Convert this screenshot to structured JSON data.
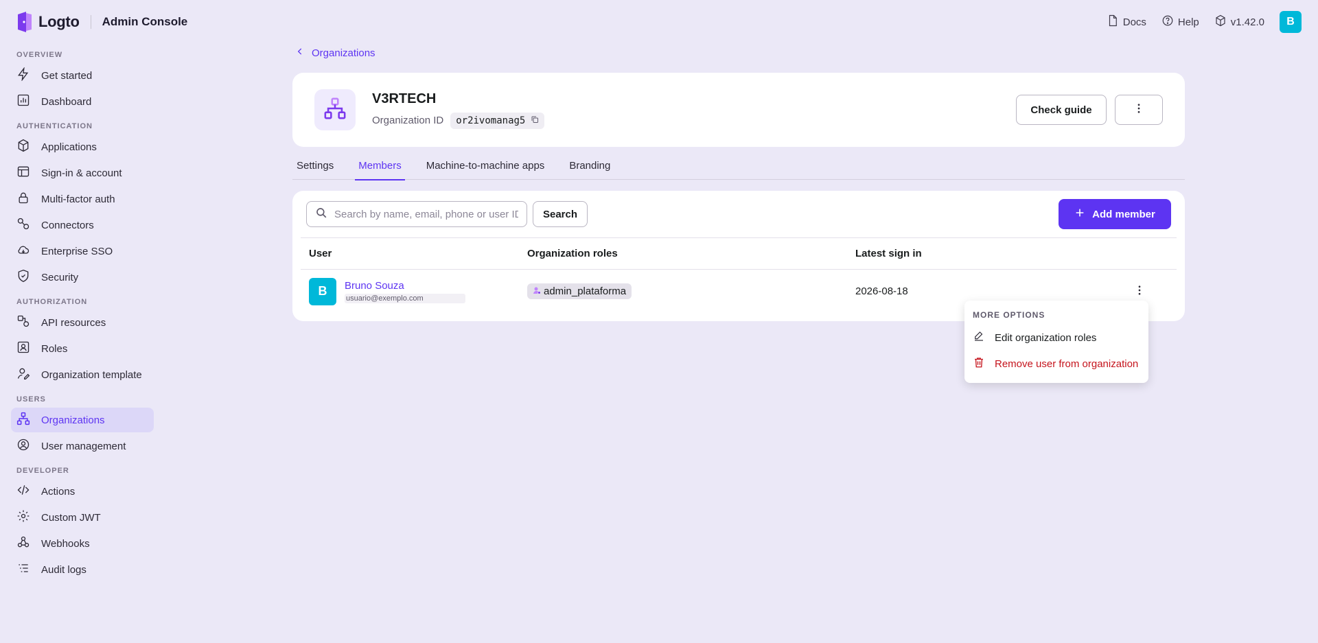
{
  "app": {
    "logo_text": "Logto",
    "console_title": "Admin Console",
    "version": "v1.42.0",
    "user_initial": "B",
    "accent_color": "#5d34f2"
  },
  "top_links": {
    "docs": "Docs",
    "help": "Help"
  },
  "sidebar": {
    "overview_title": "OVERVIEW",
    "get_started": "Get started",
    "dashboard": "Dashboard",
    "authentication_title": "AUTHENTICATION",
    "applications": "Applications",
    "sign_in": "Sign-in & account",
    "mfa": "Multi-factor auth",
    "connectors": "Connectors",
    "enterprise_sso": "Enterprise SSO",
    "security": "Security",
    "authorization_title": "AUTHORIZATION",
    "api_resources": "API resources",
    "roles": "Roles",
    "org_template": "Organization template",
    "users_title": "USERS",
    "organizations": "Organizations",
    "user_management": "User management",
    "developer_title": "DEVELOPER",
    "actions": "Actions",
    "custom_jwt": "Custom JWT",
    "webhooks": "Webhooks",
    "audit_logs": "Audit logs"
  },
  "breadcrumb": {
    "label": "Organizations"
  },
  "org": {
    "name": "V3RTECH",
    "id_label": "Organization ID",
    "id_value": "or2ivomanag5",
    "check_guide": "Check guide"
  },
  "tabs": {
    "settings": "Settings",
    "members": "Members",
    "m2m": "Machine-to-machine apps",
    "branding": "Branding"
  },
  "members": {
    "search_placeholder": "Search by name, email, phone or user ID",
    "search_button": "Search",
    "add_button": "Add member",
    "columns": {
      "user": "User",
      "roles": "Organization roles",
      "latest_sign_in": "Latest sign in"
    },
    "rows": [
      {
        "initial": "B",
        "name": "Bruno Souza",
        "email": "usuario@exemplo.com",
        "role": "admin_plataforma",
        "latest_sign_in": "2026-08-18"
      }
    ]
  },
  "dropdown": {
    "title": "MORE OPTIONS",
    "edit_roles": "Edit organization roles",
    "remove_user": "Remove user from organization"
  }
}
